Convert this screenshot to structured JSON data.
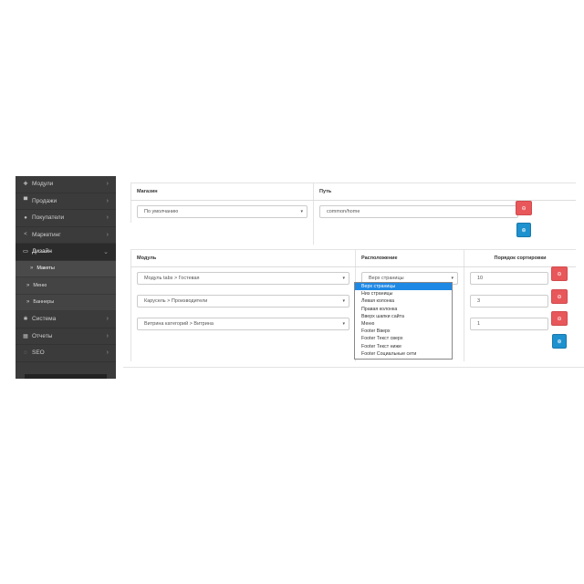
{
  "sidebar": {
    "items": [
      {
        "label": "Модули",
        "icon": "puzzle-icon",
        "glyph": "✚"
      },
      {
        "label": "Продажи",
        "icon": "cart-icon",
        "glyph": "▀"
      },
      {
        "label": "Покупатели",
        "icon": "user-icon",
        "glyph": "●"
      },
      {
        "label": "Маркетинг",
        "icon": "share-icon",
        "glyph": "<"
      },
      {
        "label": "Дизайн",
        "icon": "monitor-icon",
        "glyph": "▭"
      }
    ],
    "sub_items": [
      {
        "label": "Макеты"
      },
      {
        "label": "Меню"
      },
      {
        "label": "Баннеры"
      }
    ],
    "bottom_items": [
      {
        "label": "Система",
        "icon": "gear-icon",
        "glyph": "✱"
      },
      {
        "label": "Отчеты",
        "icon": "chart-icon",
        "glyph": "▦"
      },
      {
        "label": "SEO",
        "icon": "seo-icon",
        "glyph": "◌"
      }
    ]
  },
  "store_table": {
    "headers": [
      "Магазин",
      "Путь"
    ],
    "store_value": "По умолчанию",
    "route_value": "common/home"
  },
  "modules_table": {
    "headers": [
      "Модуль",
      "Расположение",
      "Порядок сортировки"
    ],
    "rows": [
      {
        "module": "Модуль tabs > Гостевая",
        "position": "Верх страницы",
        "sort": "10"
      },
      {
        "module": "Карусель > Производители",
        "position": "",
        "sort": "3"
      },
      {
        "module": "Витрина категорий > Витрина",
        "position": "",
        "sort": "1"
      }
    ]
  },
  "position_options": [
    "Верх страницы",
    "Низ страницы",
    "Левая колонка",
    "Правая колонка",
    "Вверх шапки сайта",
    "Меню",
    "Footer Вверх",
    "Footer Текст сверх",
    "Footer Текст ниже",
    "Footer Социальные сети"
  ],
  "selected_option_index": 0,
  "colors": {
    "danger": "#e8575a",
    "primary": "#1e91cf",
    "sidebar": "#3b3b3b"
  }
}
